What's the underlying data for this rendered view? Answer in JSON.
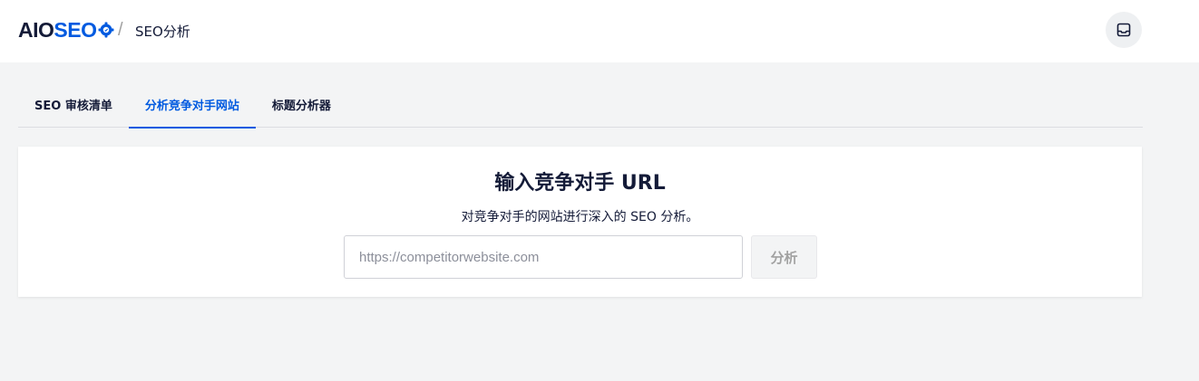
{
  "header": {
    "logo_aio": "AIO",
    "logo_seo": "SEO",
    "separator": "/",
    "breadcrumb": "SEO分析",
    "inbox_icon": "inbox-icon"
  },
  "tabs": [
    {
      "label": "SEO 审核清单",
      "active": false
    },
    {
      "label": "分析竞争对手网站",
      "active": true
    },
    {
      "label": "标题分析器",
      "active": false
    }
  ],
  "competitor": {
    "title": "输入竞争对手 URL",
    "subtitle": "对竞争对手的网站进行深入的 SEO 分析。",
    "input_value": "",
    "input_placeholder": "https://competitorwebsite.com",
    "analyze_label": "分析"
  },
  "colors": {
    "brand": "#005ae0",
    "text": "#141b38",
    "background": "#f3f4f5"
  }
}
